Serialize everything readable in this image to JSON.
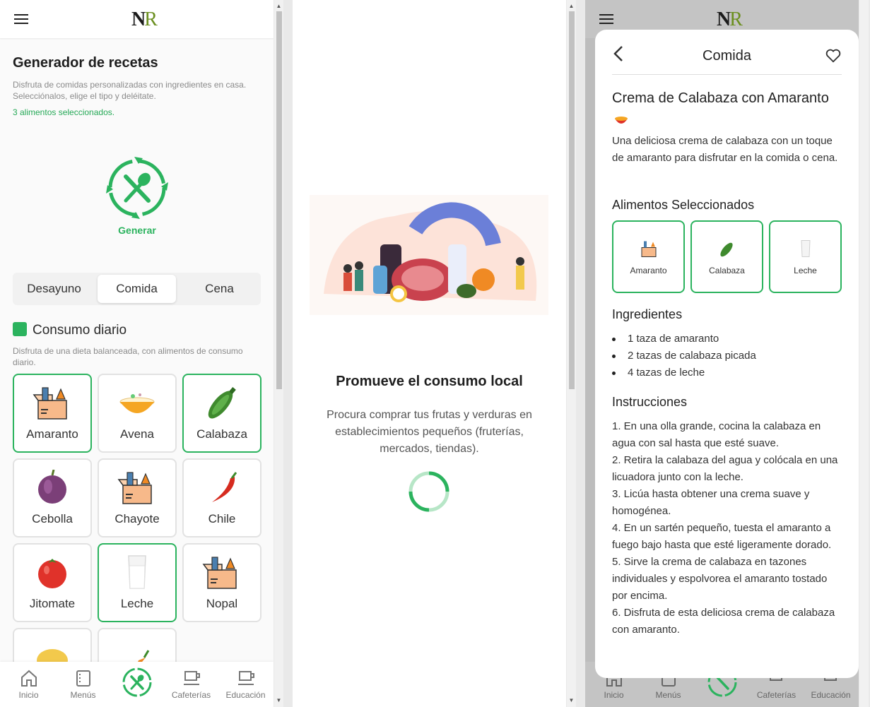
{
  "logo": {
    "n": "N",
    "r": "R"
  },
  "left": {
    "title": "Generador de recetas",
    "subtitle": "Disfruta de comidas personalizadas con ingredientes en casa. Selecciónalos, elige el tipo y deléitate.",
    "selected_count": "3 alimentos seleccionados.",
    "generate_label": "Generar",
    "tabs": [
      "Desayuno",
      "Comida",
      "Cena"
    ],
    "active_tab": "Comida",
    "section_title": "Consumo diario",
    "section_subtitle": "Disfruta de una dieta balanceada, con alimentos de consumo diario.",
    "foods": [
      {
        "label": "Amaranto",
        "icon": "grocery-box-icon",
        "selected": true
      },
      {
        "label": "Avena",
        "icon": "oat-bowl-icon",
        "selected": false
      },
      {
        "label": "Calabaza",
        "icon": "zucchini-icon",
        "selected": true
      },
      {
        "label": "Cebolla",
        "icon": "onion-icon",
        "selected": false
      },
      {
        "label": "Chayote",
        "icon": "grocery-box-icon",
        "selected": false
      },
      {
        "label": "Chile",
        "icon": "chili-icon",
        "selected": false
      },
      {
        "label": "Jitomate",
        "icon": "tomato-icon",
        "selected": false
      },
      {
        "label": "Leche",
        "icon": "milk-glass-icon",
        "selected": true
      },
      {
        "label": "Nopal",
        "icon": "grocery-box-icon",
        "selected": false
      }
    ]
  },
  "nav": [
    "Inicio",
    "Menús",
    "Cafeterías",
    "Educación"
  ],
  "middle": {
    "title": "Promueve el consumo local",
    "text": "Procura comprar tus frutas y verduras en establecimientos pequeños (fruterías, mercados, tiendas)."
  },
  "right": {
    "header_title": "Comida",
    "recipe_title": "Crema de Calabaza con Amaranto",
    "description": "Una deliciosa crema de calabaza con un toque de amaranto para disfrutar en la comida o cena.",
    "selected_title": "Alimentos Seleccionados",
    "selected": [
      "Amaranto",
      "Calabaza",
      "Leche"
    ],
    "ingredients_title": "Ingredientes",
    "ingredients": [
      "1 taza de amaranto",
      "2 tazas de calabaza picada",
      "4 tazas de leche"
    ],
    "instructions_title": "Instrucciones",
    "instructions": "1. En una olla grande, cocina la calabaza en agua con sal hasta que esté suave.\n2. Retira la calabaza del agua y colócala en una licuadora junto con la leche.\n3. Licúa hasta obtener una crema suave y homogénea.\n4. En un sartén pequeño, tuesta el amaranto a fuego bajo hasta que esté ligeramente dorado.\n5. Sirve la crema de calabaza en tazones individuales y espolvorea el amaranto tostado por encima.\n6. Disfruta de esta deliciosa crema de calabaza con amaranto."
  },
  "colors": {
    "accent": "#2bb35e",
    "selected_text": "#26a957"
  }
}
